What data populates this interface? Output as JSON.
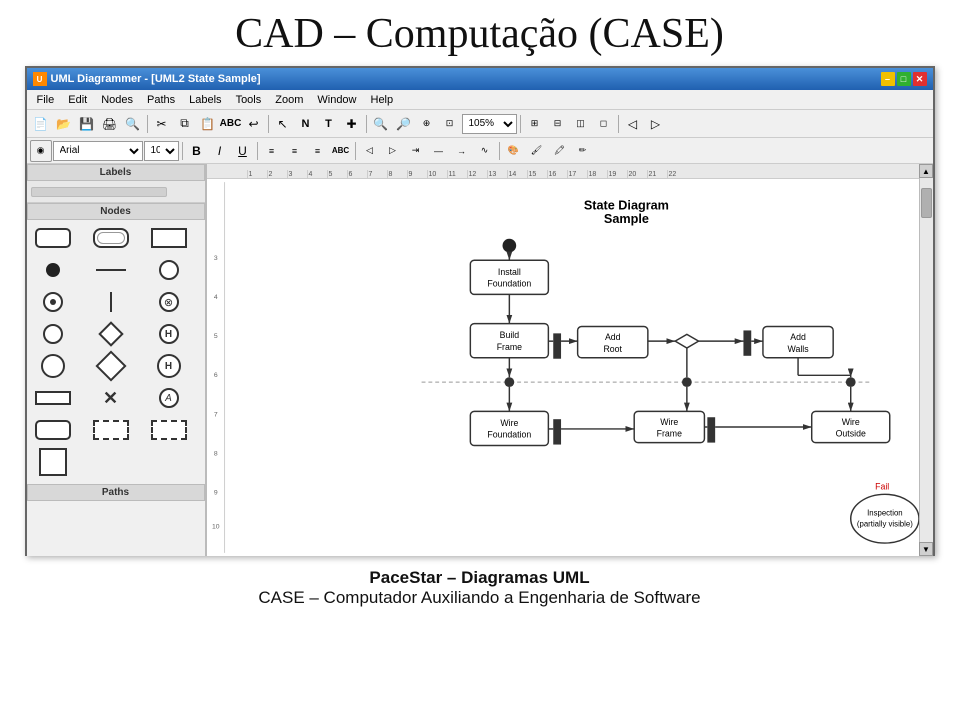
{
  "page": {
    "title": "CAD – Computação (CASE)"
  },
  "window": {
    "title": "UML Diagrammer - [UML2 State Sample]",
    "title_icon": "UML"
  },
  "menu": {
    "items": [
      "File",
      "Edit",
      "Nodes",
      "Paths",
      "Labels",
      "Tools",
      "Zoom",
      "Window",
      "Help"
    ]
  },
  "toolbar": {
    "zoom_value": "105%"
  },
  "diagram": {
    "title_line1": "State Diagram",
    "title_line2": "Sample",
    "nodes": {
      "install": "Install\nFoundation",
      "build": "Build\nFrame",
      "add_root": "Add\nRoot",
      "add_walls": "Add\nWalls",
      "wire_found": "Wire\nFoundation",
      "wire_frame": "Wire\nFrame",
      "wire_outside": "Wire\nOutside",
      "inspection": "Inspection",
      "fail": "Fail"
    }
  },
  "left_panel": {
    "labels_header": "Labels",
    "nodes_header": "Nodes",
    "paths_header": "Paths"
  },
  "ruler": {
    "marks": [
      "1",
      "2",
      "3",
      "4",
      "5",
      "6",
      "7",
      "8",
      "9",
      "10",
      "11",
      "12",
      "13",
      "14",
      "15",
      "16",
      "17",
      "18",
      "19",
      "20",
      "21",
      "22"
    ]
  },
  "footer": {
    "line1": "PaceStar – Diagramas UML",
    "line2": "CASE – Computador Auxiliando a Engenharia de Software"
  }
}
